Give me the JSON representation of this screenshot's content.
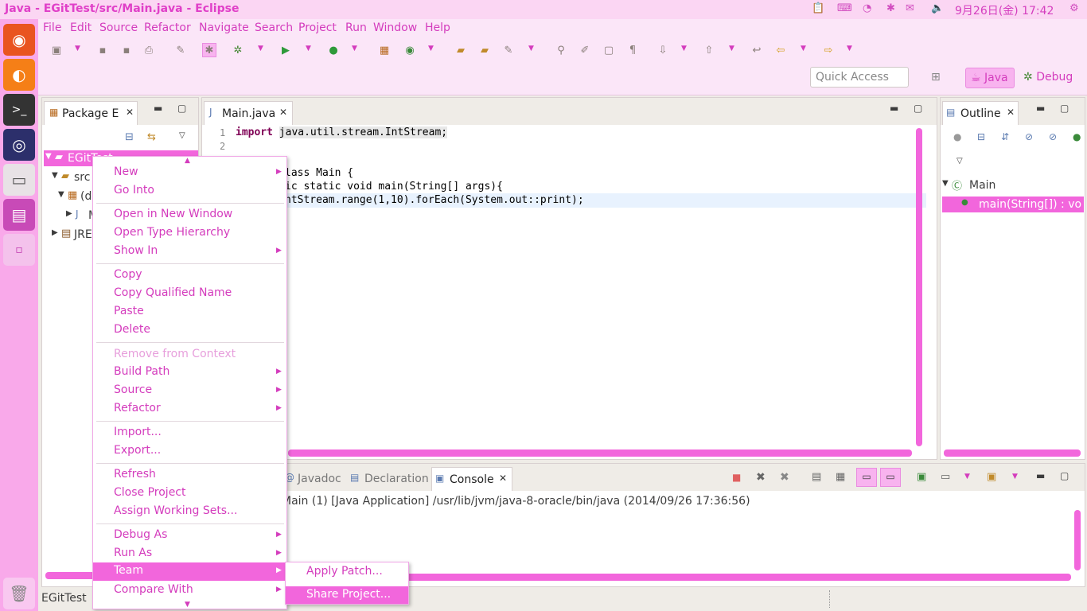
{
  "topbar": {
    "title": "Java - EGitTest/src/Main.java - Eclipse",
    "clock": "9月26日(金) 17:42"
  },
  "menubar": [
    "File",
    "Edit",
    "Source",
    "Refactor",
    "Navigate",
    "Search",
    "Project",
    "Run",
    "Window",
    "Help"
  ],
  "toolbar": {
    "quick_access_placeholder": "Quick Access",
    "perspective_java": "Java",
    "perspective_debug": "Debug"
  },
  "package_explorer": {
    "tab": "Package E",
    "project": "EGitTest",
    "tree": [
      "src",
      "(d",
      "M",
      "JRE"
    ]
  },
  "editor": {
    "tab": "Main.java",
    "lines": [
      {
        "n": "1",
        "text": "import java.util.stream.IntStream;"
      },
      {
        "n": "2",
        "text": ""
      },
      {
        "n": "",
        "text": "lass Main {"
      },
      {
        "n": "",
        "text": "ic static void main(String[] args){"
      },
      {
        "n": "",
        "text": "ntStream.range(1,10).forEach(System.out::print);"
      }
    ]
  },
  "outline": {
    "tab": "Outline",
    "class": "Main",
    "method": "main(String[]) : void"
  },
  "console": {
    "tabs": [
      "Javadoc",
      "Declaration",
      "Console"
    ],
    "status": "Main (1) [Java Application] /usr/lib/jvm/java-8-oracle/bin/java (2014/09/26 17:36:56)"
  },
  "statusbar": {
    "text": "EGitTest"
  },
  "context_menu": {
    "items": [
      {
        "label": "New",
        "submenu": true
      },
      {
        "label": "Go Into"
      },
      {
        "label": "Open in New Window"
      },
      {
        "label": "Open Type Hierarchy"
      },
      {
        "label": "Show In",
        "submenu": true
      },
      {
        "label": "Copy"
      },
      {
        "label": "Copy Qualified Name"
      },
      {
        "label": "Paste"
      },
      {
        "label": "Delete"
      },
      {
        "label": "Remove from Context",
        "disabled": true
      },
      {
        "label": "Build Path",
        "submenu": true
      },
      {
        "label": "Source",
        "submenu": true
      },
      {
        "label": "Refactor",
        "submenu": true
      },
      {
        "label": "Import..."
      },
      {
        "label": "Export..."
      },
      {
        "label": "Refresh"
      },
      {
        "label": "Close Project"
      },
      {
        "label": "Assign Working Sets..."
      },
      {
        "label": "Debug As",
        "submenu": true
      },
      {
        "label": "Run As",
        "submenu": true
      },
      {
        "label": "Team",
        "submenu": true,
        "highlighted": true
      },
      {
        "label": "Compare With",
        "submenu": true
      }
    ]
  },
  "team_submenu": {
    "items": [
      "Apply Patch...",
      "Share Project..."
    ]
  },
  "colors": {
    "accent": "#d43cbd",
    "highlight": "#f266dc",
    "launcher": "#f9a9ea"
  }
}
